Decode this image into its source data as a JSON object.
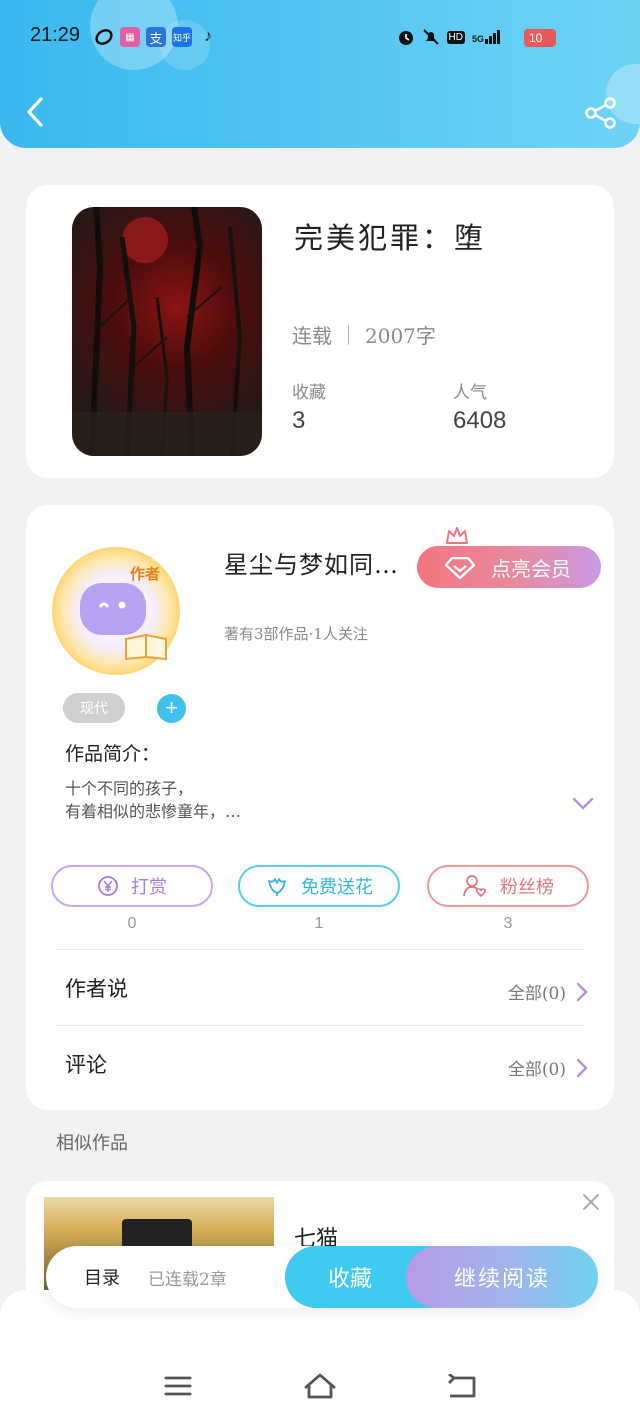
{
  "status_bar": {
    "time": "21:29",
    "network": "5G",
    "hd": "HD",
    "battery": "10",
    "apps": [
      "bilibili",
      "alipay",
      "zhihu",
      "tiktok"
    ],
    "app_labels": {
      "zhihu": "知乎",
      "alipay": "支"
    }
  },
  "nav": {
    "back_icon": "chevron-left-icon",
    "share_icon": "share-icon"
  },
  "book": {
    "title": "完美犯罪：堕",
    "status": "连载",
    "word_count": "2007字",
    "collect_label": "收藏",
    "collect_value": "3",
    "popularity_label": "人气",
    "popularity_value": "6408"
  },
  "author": {
    "avatar_tag": "作者",
    "name": "星尘与梦如同…",
    "vip_button": "点亮会员",
    "summary": "著有3部作品·1人关注",
    "genre_tag": "现代",
    "add_tag": "+",
    "intro_title": "作品简介：",
    "intro_lines": [
      "十个不同的孩子，",
      "有着相似的悲惨童年，…"
    ]
  },
  "actions": [
    {
      "label": "打赏",
      "count": "0",
      "icon": "yen-icon"
    },
    {
      "label": "免费送花",
      "count": "1",
      "icon": "flower-icon"
    },
    {
      "label": "粉丝榜",
      "count": "3",
      "icon": "fans-icon"
    }
  ],
  "sections": {
    "author_says": {
      "title": "作者说",
      "link": "全部(0)"
    },
    "comments": {
      "title": "评论",
      "link": "全部(0)"
    }
  },
  "similar": {
    "label": "相似作品",
    "items": [
      {
        "title": "七猫"
      }
    ]
  },
  "bottom_bar": {
    "toc": "目录",
    "toc_sub": "已连载2章",
    "favorite": "收藏",
    "continue_reading": "继续阅读"
  },
  "system_nav": [
    "menu-icon",
    "home-icon",
    "back-icon"
  ],
  "colors": {
    "header_blue": "#39b8ee",
    "accent_cyan": "#3fcaf0",
    "accent_purple": "#b99be8",
    "vip_red": "#f2757e"
  }
}
